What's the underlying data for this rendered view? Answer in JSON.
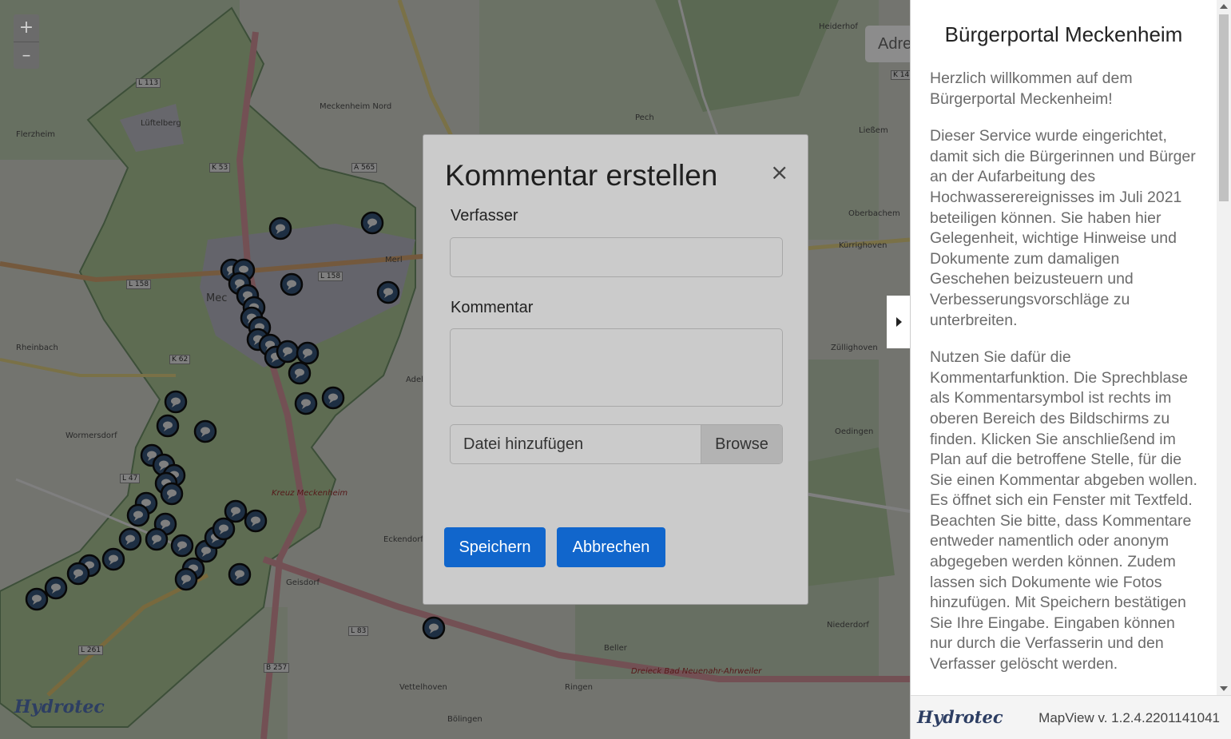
{
  "map": {
    "zoom_in": "+",
    "zoom_out": "–",
    "address_placeholder": "Adre",
    "watermark_brand": "Hydrotec",
    "places": [
      "Lüftelberg",
      "Flerzheim",
      "Meckenheim Nord",
      "Merl",
      "Mec",
      "Rheinbach",
      "Wormersdorf",
      "Eckendorf",
      "Geisdorf",
      "Adel",
      "Pech",
      "Ließem",
      "Oberbachem",
      "Kürrighoven",
      "Züllighoven",
      "Oedingen",
      "Niederdorf",
      "Ringen",
      "Beller",
      "Vettelhoven",
      "Bölingen",
      "Heiderhof",
      "Kreuz Meckenheim",
      "Dreieck Bad Neuenahr-Ahrweiler"
    ],
    "roads": [
      "L 113",
      "K 53",
      "A 565",
      "L 158",
      "L 158",
      "K 62",
      "L 47",
      "L 261",
      "L 83",
      "B 257",
      "K 14"
    ],
    "marker_icon": "comment-bubble-icon",
    "collapse_icon": "caret-right-icon"
  },
  "panel": {
    "title": "Bürgerportal Meckenheim",
    "paragraphs": [
      "Herzlich willkommen auf dem Bürgerportal Meckenheim!",
      "Dieser Service wurde eingerichtet, damit sich die Bürgerinnen und Bürger an der Aufarbeitung des Hochwasserereignisses im Juli 2021 beteiligen können. Sie haben hier Gelegenheit, wichtige Hinweise und Dokumente zum damaligen Geschehen beizusteuern und Verbesserungsvorschläge zu unterbreiten.",
      "Nutzen Sie dafür die Kommentarfunktion. Die Sprechblase als Kommentarsymbol ist rechts im oberen Bereich des Bildschirms zu finden. Klicken Sie anschließend im Plan auf die betroffene Stelle, für die Sie einen Kommentar abgeben wollen. Es öffnet sich ein Fenster mit Textfeld. Beachten Sie bitte, dass Kommentare entweder namentlich oder anonym abgegeben werden können. Zudem lassen sich Dokumente wie Fotos hinzufügen. Mit Speichern bestätigen Sie Ihre Eingabe. Eingaben können nur durch die Verfasserin und den Verfasser gelöscht werden."
    ],
    "footer_brand": "Hydrotec",
    "version": "MapView v. 1.2.4.2201141041"
  },
  "modal": {
    "title": "Kommentar erstellen",
    "close": "×",
    "author_label": "Verfasser",
    "author_value": "",
    "comment_label": "Kommentar",
    "comment_value": "",
    "file_label": "Datei hinzufügen",
    "browse_label": "Browse",
    "save_label": "Speichern",
    "cancel_label": "Abbrechen"
  },
  "colors": {
    "primary_button": "#1166cc",
    "marker_fill": "#3d5e86",
    "brand": "#2d3e63"
  }
}
